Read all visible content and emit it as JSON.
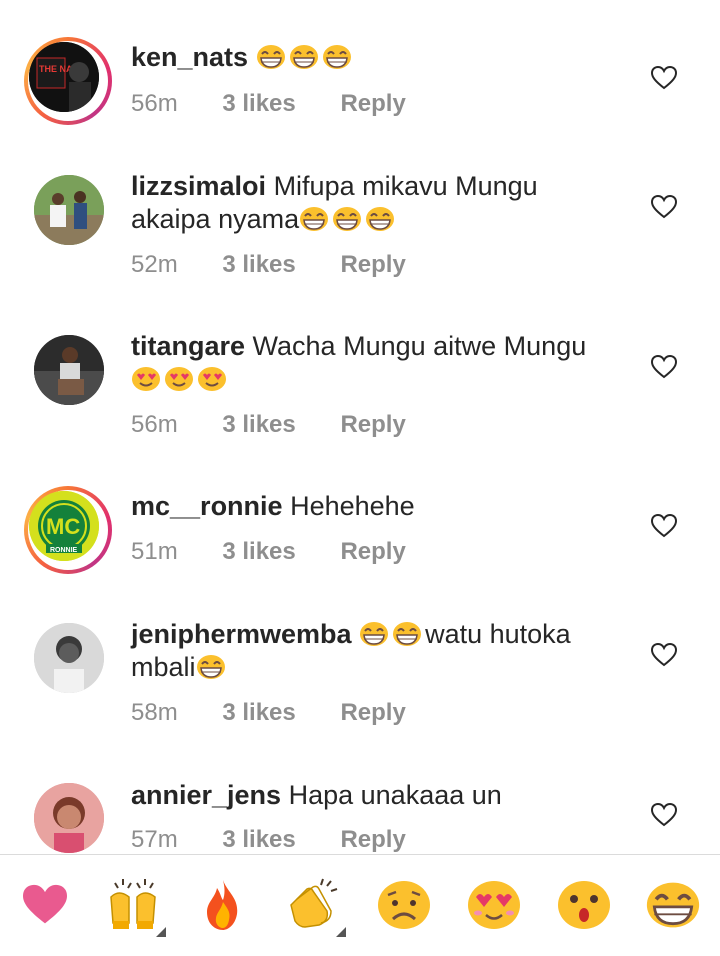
{
  "comments": [
    {
      "username": "ken_nats",
      "text": "",
      "time": "56m",
      "likes": "3 likes",
      "reply": "Reply"
    },
    {
      "username": "lizzsimaloi",
      "text": "Mifupa mikavu Mungu akaipa nyama",
      "time": "52m",
      "likes": "3 likes",
      "reply": "Reply"
    },
    {
      "username": "titangare",
      "text": "Wacha Mungu aitwe Mungu",
      "time": "56m",
      "likes": "3 likes",
      "reply": "Reply"
    },
    {
      "username": "mc__ronnie",
      "text": "Hehehehe",
      "time": "51m",
      "likes": "3 likes",
      "reply": "Reply"
    },
    {
      "username": "jeniphermwemba",
      "text_after": "watu hutoka mbali",
      "time": "58m",
      "likes": "3 likes",
      "reply": "Reply"
    },
    {
      "username": "annier_jens",
      "text": "Hapa unakaaa un",
      "time": "57m",
      "likes": "3 likes",
      "reply": "Reply"
    }
  ],
  "avatars": {
    "ken_nats_text": "THE NATS",
    "mc_ronnie_text": "MC",
    "mc_ronnie_sub": "RONNIE"
  },
  "reaction_bar": [
    "heart",
    "raising-hands",
    "fire",
    "clapping-hands",
    "sad-face",
    "heart-eyes-face",
    "surprised-face",
    "grinning-face"
  ],
  "colors": {
    "heart": "#e95a8f",
    "meta": "#8e8e8e",
    "text": "#262626",
    "emoji": "#fbc02d"
  }
}
